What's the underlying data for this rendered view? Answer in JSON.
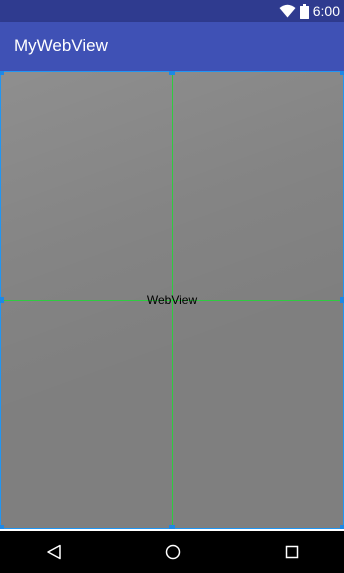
{
  "status_bar": {
    "time": "6:00",
    "icons": [
      "wifi-icon",
      "battery-icon"
    ]
  },
  "app_bar": {
    "title": "MyWebView"
  },
  "webview": {
    "label": "WebView"
  },
  "nav_bar": {
    "buttons": [
      "back-icon",
      "home-icon",
      "recents-icon"
    ]
  },
  "colors": {
    "status_bar": "#2f3b8f",
    "app_bar": "#3f51b5",
    "webview_background": "#7f7f7f",
    "selection_border": "#2196f3",
    "guide_lines": "#2ecc40",
    "nav_bar": "#000000"
  }
}
